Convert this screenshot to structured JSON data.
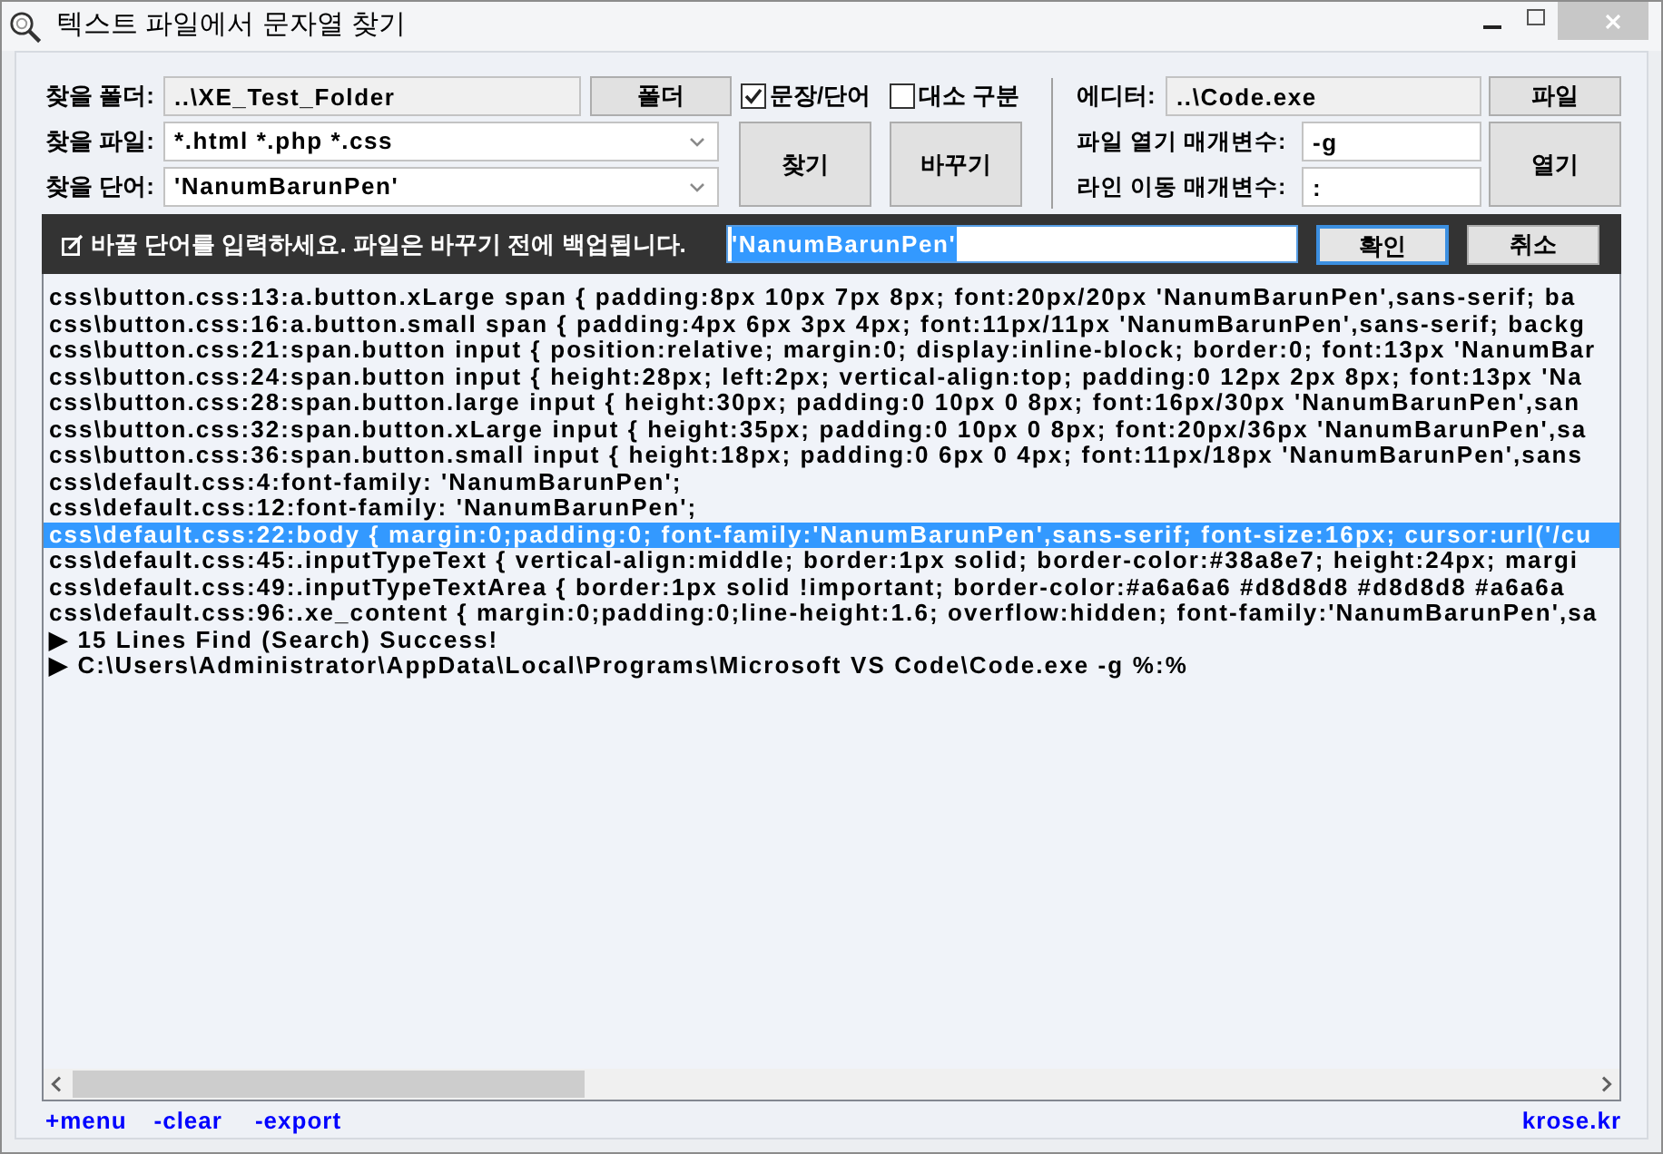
{
  "window": {
    "title": "텍스트 파일에서 문자열 찾기"
  },
  "search_panel": {
    "folder": {
      "label": "찾을 폴더:",
      "value": "..\\XE_Test_Folder",
      "button": "폴더"
    },
    "file_pattern": {
      "label": "찾을 파일:",
      "value": "*.html *.php *.css"
    },
    "search_word": {
      "label": "찾을 단어:",
      "value": "'NanumBarunPen'"
    },
    "options": [
      {
        "label": "문장/단어",
        "checked": true
      },
      {
        "label": "대소 구분",
        "checked": false
      }
    ],
    "actions": [
      "찾기",
      "바꾸기"
    ]
  },
  "editor_panel": {
    "editor": {
      "label": "에디터:",
      "value": "..\\Code.exe",
      "button": "파일"
    },
    "open_params": {
      "label": "파일 열기 매개변수:",
      "value": "-g"
    },
    "line_params": {
      "label": "라인 이동 매개변수:",
      "value": ":"
    },
    "open_button": "열기"
  },
  "replace_prompt": {
    "message": "바꿀 단어를 입력하세요. 파일은 바꾸기 전에 백업됩니다.",
    "value": "'NanumBarunPen'",
    "value_selected": true,
    "buttons": [
      {
        "label": "확인",
        "focused": true
      },
      {
        "label": "취소",
        "focused": false
      }
    ]
  },
  "results": {
    "rows": [
      {
        "text": "css\\button.css:13:a.button.xLarge span { padding:8px 10px 7px 8px; font:20px/20px 'NanumBarunPen',sans-serif; ba",
        "selected": false
      },
      {
        "text": "css\\button.css:16:a.button.small span { padding:4px 6px 3px 4px; font:11px/11px 'NanumBarunPen',sans-serif; backg",
        "selected": false
      },
      {
        "text": "css\\button.css:21:span.button input { position:relative; margin:0; display:inline-block; border:0; font:13px 'NanumBar",
        "selected": false
      },
      {
        "text": "css\\button.css:24:span.button input { height:28px; left:2px; vertical-align:top; padding:0 12px 2px 8px; font:13px 'Na",
        "selected": false
      },
      {
        "text": "css\\button.css:28:span.button.large input { height:30px; padding:0 10px 0 8px; font:16px/30px 'NanumBarunPen',san",
        "selected": false
      },
      {
        "text": "css\\button.css:32:span.button.xLarge input { height:35px; padding:0 10px 0 8px; font:20px/36px 'NanumBarunPen',sa",
        "selected": false
      },
      {
        "text": "css\\button.css:36:span.button.small input { height:18px; padding:0 6px 0 4px; font:11px/18px 'NanumBarunPen',sans",
        "selected": false
      },
      {
        "text": "css\\default.css:4:font-family: 'NanumBarunPen';",
        "selected": false
      },
      {
        "text": "css\\default.css:12:font-family: 'NanumBarunPen';",
        "selected": false
      },
      {
        "text": "css\\default.css:22:body { margin:0;padding:0; font-family:'NanumBarunPen',sans-serif; font-size:16px; cursor:url('/cu",
        "selected": true
      },
      {
        "text": "css\\default.css:45:.inputTypeText { vertical-align:middle; border:1px solid; border-color:#38a8e7; height:24px; margi",
        "selected": false
      },
      {
        "text": "css\\default.css:49:.inputTypeTextArea { border:1px solid !important; border-color:#a6a6a6 #d8d8d8 #d8d8d8 #a6a6a",
        "selected": false
      },
      {
        "text": "css\\default.css:96:.xe_content { margin:0;padding:0;line-height:1.6; overflow:hidden; font-family:'NanumBarunPen',sa",
        "selected": false
      },
      {
        "text": "▶ 15 Lines Find (Search) Success!",
        "selected": false
      },
      {
        "text": "▶ C:\\Users\\Administrator\\AppData\\Local\\Programs\\Microsoft VS Code\\Code.exe -g %:%",
        "selected": false
      }
    ]
  },
  "footer": {
    "links": [
      "+menu",
      "-clear",
      "-export"
    ],
    "site_link": "krose.kr"
  }
}
